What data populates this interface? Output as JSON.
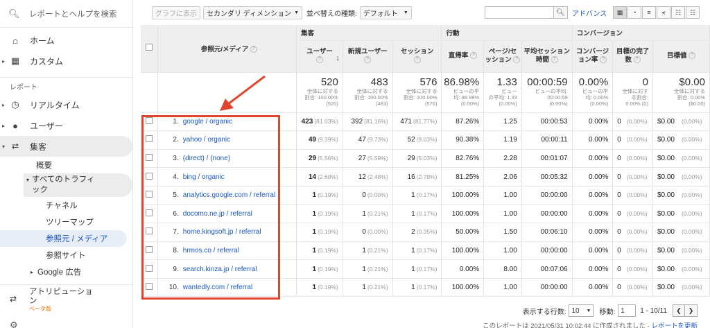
{
  "sidebar": {
    "search_placeholder": "レポートとヘルプを検索",
    "home": "ホーム",
    "custom": "カスタム",
    "reports_section": "レポート",
    "realtime": "リアルタイム",
    "users": "ユーザー",
    "acquisition": "集客",
    "overview": "概要",
    "all_traffic": "すべてのトラフィ",
    "all_traffic_2": "ック",
    "channels": "チャネル",
    "treemap": "ツリーマップ",
    "source_medium": "参照元 / メディア",
    "referrals": "参照サイト",
    "google_ads": "Google 広告",
    "attribution": "アトリビューショ",
    "attribution_2": "ン",
    "beta": "ベータ版"
  },
  "toolbar": {
    "plot_rows": "グラフに表示",
    "secondary_dimension": "セカンダリ ディメンション",
    "sort_type_label": "並べ替えの種類:",
    "sort_type_value": "デフォルト",
    "advanced": "アドバンス"
  },
  "table": {
    "groups": {
      "acquisition": "集客",
      "behavior": "行動",
      "conversions": "コンバージョン"
    },
    "headers": {
      "source_medium": "参照元/メディア",
      "users": "ユーザー",
      "new_users": "新規ユーザー",
      "sessions": "セッション",
      "bounce_rate": "直帰率",
      "pages_session_1": "ページ/セ",
      "pages_session_2": "ッション",
      "avg_duration_1": "平均セッション",
      "avg_duration_2": "時間",
      "conv_rate_1": "コンバージ",
      "conv_rate_2": "ョン率",
      "goal_completions_1": "目標の完了",
      "goal_completions_2": "数",
      "goal_value": "目標値"
    },
    "totals": {
      "users": "520",
      "users_sub1": "全体に対する",
      "users_sub2": "割合: 100.00%",
      "users_sub3": "(520)",
      "new_users": "483",
      "new_users_sub1": "全体に対する",
      "new_users_sub2": "割合: 100.00%",
      "new_users_sub3": "(483)",
      "sessions": "576",
      "sessions_sub1": "全体に対する",
      "sessions_sub2": "割合: 100.00%",
      "sessions_sub3": "(576)",
      "bounce": "86.98%",
      "bounce_sub1": "ビューの平",
      "bounce_sub2": "均: 86.98%",
      "bounce_sub3": "(0.00%)",
      "pages": "1.33",
      "pages_sub1": "ビュー",
      "pages_sub2": "の平均: 1.33",
      "pages_sub3": "(0.00%)",
      "duration": "00:00:59",
      "duration_sub1": "ビューの平均: 00:00:59",
      "duration_sub2": "(0.00%)",
      "conv": "0.00%",
      "conv_sub1": "ビューの平",
      "conv_sub2": "均: 0.00%",
      "conv_sub3": "(0.00%)",
      "goals": "0",
      "goals_sub1": "全体に対す",
      "goals_sub2": "る割合:",
      "goals_sub3": "0.00% (0)",
      "value": "$0.00",
      "value_sub1": "全体に対する",
      "value_sub2": "割合: 0.00%",
      "value_sub3": "($0.00)"
    },
    "rows": [
      {
        "idx": "1.",
        "src": "google / organic",
        "users": "423",
        "users_pct": "(81.03%)",
        "new": "392",
        "new_pct": "(81.16%)",
        "sess": "471",
        "sess_pct": "(81.77%)",
        "bounce": "87.26%",
        "pages": "1.25",
        "dur": "00:00:53",
        "conv": "0.00%",
        "goals": "0",
        "goals_pct": "(0.00%)",
        "val": "$0.00",
        "val_pct": "(0.00%)"
      },
      {
        "idx": "2.",
        "src": "yahoo / organic",
        "users": "49",
        "users_pct": "(9.39%)",
        "new": "47",
        "new_pct": "(9.73%)",
        "sess": "52",
        "sess_pct": "(9.03%)",
        "bounce": "90.38%",
        "pages": "1.19",
        "dur": "00:00:11",
        "conv": "0.00%",
        "goals": "0",
        "goals_pct": "(0.00%)",
        "val": "$0.00",
        "val_pct": "(0.00%)"
      },
      {
        "idx": "3.",
        "src": "(direct) / (none)",
        "users": "29",
        "users_pct": "(5.56%)",
        "new": "27",
        "new_pct": "(5.59%)",
        "sess": "29",
        "sess_pct": "(5.03%)",
        "bounce": "82.76%",
        "pages": "2.28",
        "dur": "00:01:07",
        "conv": "0.00%",
        "goals": "0",
        "goals_pct": "(0.00%)",
        "val": "$0.00",
        "val_pct": "(0.00%)"
      },
      {
        "idx": "4.",
        "src": "bing / organic",
        "users": "14",
        "users_pct": "(2.68%)",
        "new": "12",
        "new_pct": "(2.48%)",
        "sess": "16",
        "sess_pct": "(2.78%)",
        "bounce": "81.25%",
        "pages": "2.06",
        "dur": "00:05:32",
        "conv": "0.00%",
        "goals": "0",
        "goals_pct": "(0.00%)",
        "val": "$0.00",
        "val_pct": "(0.00%)"
      },
      {
        "idx": "5.",
        "src": "analytics.google.com / referral",
        "users": "1",
        "users_pct": "(0.19%)",
        "new": "0",
        "new_pct": "(0.00%)",
        "sess": "1",
        "sess_pct": "(0.17%)",
        "bounce": "100.00%",
        "pages": "1.00",
        "dur": "00:00:00",
        "conv": "0.00%",
        "goals": "0",
        "goals_pct": "(0.00%)",
        "val": "$0.00",
        "val_pct": "(0.00%)"
      },
      {
        "idx": "6.",
        "src": "docomo.ne.jp / referral",
        "users": "1",
        "users_pct": "(0.19%)",
        "new": "1",
        "new_pct": "(0.21%)",
        "sess": "1",
        "sess_pct": "(0.17%)",
        "bounce": "100.00%",
        "pages": "1.00",
        "dur": "00:00:00",
        "conv": "0.00%",
        "goals": "0",
        "goals_pct": "(0.00%)",
        "val": "$0.00",
        "val_pct": "(0.00%)"
      },
      {
        "idx": "7.",
        "src": "home.kingsoft.jp / referral",
        "users": "1",
        "users_pct": "(0.19%)",
        "new": "0",
        "new_pct": "(0.00%)",
        "sess": "2",
        "sess_pct": "(0.35%)",
        "bounce": "50.00%",
        "pages": "1.50",
        "dur": "00:06:10",
        "conv": "0.00%",
        "goals": "0",
        "goals_pct": "(0.00%)",
        "val": "$0.00",
        "val_pct": "(0.00%)"
      },
      {
        "idx": "8.",
        "src": "hrmos.co / referral",
        "users": "1",
        "users_pct": "(0.19%)",
        "new": "1",
        "new_pct": "(0.21%)",
        "sess": "1",
        "sess_pct": "(0.17%)",
        "bounce": "100.00%",
        "pages": "1.00",
        "dur": "00:00:00",
        "conv": "0.00%",
        "goals": "0",
        "goals_pct": "(0.00%)",
        "val": "$0.00",
        "val_pct": "(0.00%)"
      },
      {
        "idx": "9.",
        "src": "search.kinza.jp / referral",
        "users": "1",
        "users_pct": "(0.19%)",
        "new": "1",
        "new_pct": "(0.21%)",
        "sess": "1",
        "sess_pct": "(0.17%)",
        "bounce": "0.00%",
        "pages": "8.00",
        "dur": "00:07:06",
        "conv": "0.00%",
        "goals": "0",
        "goals_pct": "(0.00%)",
        "val": "$0.00",
        "val_pct": "(0.00%)"
      },
      {
        "idx": "10.",
        "src": "wantedly.com / referral",
        "users": "1",
        "users_pct": "(0.19%)",
        "new": "1",
        "new_pct": "(0.21%)",
        "sess": "1",
        "sess_pct": "(0.17%)",
        "bounce": "100.00%",
        "pages": "1.00",
        "dur": "00:00:00",
        "conv": "0.00%",
        "goals": "0",
        "goals_pct": "(0.00%)",
        "val": "$0.00",
        "val_pct": "(0.00%)"
      }
    ]
  },
  "pager": {
    "rows_label": "表示する行数:",
    "rows_value": "10",
    "goto_label": "移動:",
    "goto_value": "1",
    "range": "1 - 10/11"
  },
  "footer": {
    "note": "このレポートは 2021/05/31 10:02:44 に作成されました - ",
    "refresh": "レポートを更新"
  },
  "colors": {
    "accent": "#1a57c4",
    "annotation": "#e0452e"
  }
}
